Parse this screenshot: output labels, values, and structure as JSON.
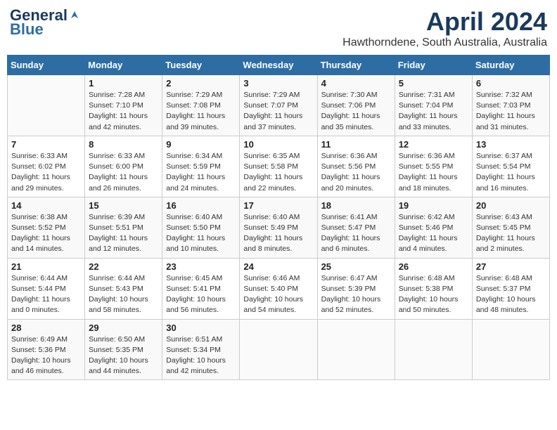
{
  "header": {
    "logo_line1": "General",
    "logo_line2": "Blue",
    "title": "April 2024",
    "subtitle": "Hawthorndene, South Australia, Australia"
  },
  "days_of_week": [
    "Sunday",
    "Monday",
    "Tuesday",
    "Wednesday",
    "Thursday",
    "Friday",
    "Saturday"
  ],
  "weeks": [
    [
      {
        "day": "",
        "info": ""
      },
      {
        "day": "1",
        "info": "Sunrise: 7:28 AM\nSunset: 7:10 PM\nDaylight: 11 hours\nand 42 minutes."
      },
      {
        "day": "2",
        "info": "Sunrise: 7:29 AM\nSunset: 7:08 PM\nDaylight: 11 hours\nand 39 minutes."
      },
      {
        "day": "3",
        "info": "Sunrise: 7:29 AM\nSunset: 7:07 PM\nDaylight: 11 hours\nand 37 minutes."
      },
      {
        "day": "4",
        "info": "Sunrise: 7:30 AM\nSunset: 7:06 PM\nDaylight: 11 hours\nand 35 minutes."
      },
      {
        "day": "5",
        "info": "Sunrise: 7:31 AM\nSunset: 7:04 PM\nDaylight: 11 hours\nand 33 minutes."
      },
      {
        "day": "6",
        "info": "Sunrise: 7:32 AM\nSunset: 7:03 PM\nDaylight: 11 hours\nand 31 minutes."
      }
    ],
    [
      {
        "day": "7",
        "info": "Sunrise: 6:33 AM\nSunset: 6:02 PM\nDaylight: 11 hours\nand 29 minutes."
      },
      {
        "day": "8",
        "info": "Sunrise: 6:33 AM\nSunset: 6:00 PM\nDaylight: 11 hours\nand 26 minutes."
      },
      {
        "day": "9",
        "info": "Sunrise: 6:34 AM\nSunset: 5:59 PM\nDaylight: 11 hours\nand 24 minutes."
      },
      {
        "day": "10",
        "info": "Sunrise: 6:35 AM\nSunset: 5:58 PM\nDaylight: 11 hours\nand 22 minutes."
      },
      {
        "day": "11",
        "info": "Sunrise: 6:36 AM\nSunset: 5:56 PM\nDaylight: 11 hours\nand 20 minutes."
      },
      {
        "day": "12",
        "info": "Sunrise: 6:36 AM\nSunset: 5:55 PM\nDaylight: 11 hours\nand 18 minutes."
      },
      {
        "day": "13",
        "info": "Sunrise: 6:37 AM\nSunset: 5:54 PM\nDaylight: 11 hours\nand 16 minutes."
      }
    ],
    [
      {
        "day": "14",
        "info": "Sunrise: 6:38 AM\nSunset: 5:52 PM\nDaylight: 11 hours\nand 14 minutes."
      },
      {
        "day": "15",
        "info": "Sunrise: 6:39 AM\nSunset: 5:51 PM\nDaylight: 11 hours\nand 12 minutes."
      },
      {
        "day": "16",
        "info": "Sunrise: 6:40 AM\nSunset: 5:50 PM\nDaylight: 11 hours\nand 10 minutes."
      },
      {
        "day": "17",
        "info": "Sunrise: 6:40 AM\nSunset: 5:49 PM\nDaylight: 11 hours\nand 8 minutes."
      },
      {
        "day": "18",
        "info": "Sunrise: 6:41 AM\nSunset: 5:47 PM\nDaylight: 11 hours\nand 6 minutes."
      },
      {
        "day": "19",
        "info": "Sunrise: 6:42 AM\nSunset: 5:46 PM\nDaylight: 11 hours\nand 4 minutes."
      },
      {
        "day": "20",
        "info": "Sunrise: 6:43 AM\nSunset: 5:45 PM\nDaylight: 11 hours\nand 2 minutes."
      }
    ],
    [
      {
        "day": "21",
        "info": "Sunrise: 6:44 AM\nSunset: 5:44 PM\nDaylight: 11 hours\nand 0 minutes."
      },
      {
        "day": "22",
        "info": "Sunrise: 6:44 AM\nSunset: 5:43 PM\nDaylight: 10 hours\nand 58 minutes."
      },
      {
        "day": "23",
        "info": "Sunrise: 6:45 AM\nSunset: 5:41 PM\nDaylight: 10 hours\nand 56 minutes."
      },
      {
        "day": "24",
        "info": "Sunrise: 6:46 AM\nSunset: 5:40 PM\nDaylight: 10 hours\nand 54 minutes."
      },
      {
        "day": "25",
        "info": "Sunrise: 6:47 AM\nSunset: 5:39 PM\nDaylight: 10 hours\nand 52 minutes."
      },
      {
        "day": "26",
        "info": "Sunrise: 6:48 AM\nSunset: 5:38 PM\nDaylight: 10 hours\nand 50 minutes."
      },
      {
        "day": "27",
        "info": "Sunrise: 6:48 AM\nSunset: 5:37 PM\nDaylight: 10 hours\nand 48 minutes."
      }
    ],
    [
      {
        "day": "28",
        "info": "Sunrise: 6:49 AM\nSunset: 5:36 PM\nDaylight: 10 hours\nand 46 minutes."
      },
      {
        "day": "29",
        "info": "Sunrise: 6:50 AM\nSunset: 5:35 PM\nDaylight: 10 hours\nand 44 minutes."
      },
      {
        "day": "30",
        "info": "Sunrise: 6:51 AM\nSunset: 5:34 PM\nDaylight: 10 hours\nand 42 minutes."
      },
      {
        "day": "",
        "info": ""
      },
      {
        "day": "",
        "info": ""
      },
      {
        "day": "",
        "info": ""
      },
      {
        "day": "",
        "info": ""
      }
    ]
  ]
}
